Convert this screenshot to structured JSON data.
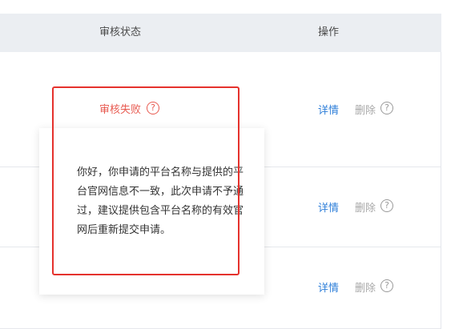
{
  "table": {
    "headers": {
      "status": "审核状态",
      "actions": "操作"
    },
    "rows": [
      {
        "status": "审核失败",
        "detail": "详情",
        "delete": "删除"
      },
      {
        "detail": "详情",
        "delete": "删除"
      },
      {
        "detail": "详情",
        "delete": "删除"
      }
    ]
  },
  "tooltip": {
    "message": "你好，你申请的平台名称与提供的平台官网信息不一致，此次申请不予通过，建议提供包含平台名称的有效官网后重新提交申请。"
  },
  "icons": {
    "help": "question-circle-icon"
  },
  "colors": {
    "fail": "#e85a50",
    "link": "#2f7fd9",
    "muted": "#a8a8a8",
    "highlight": "#e5322d",
    "header_bg": "#ebeef2"
  }
}
